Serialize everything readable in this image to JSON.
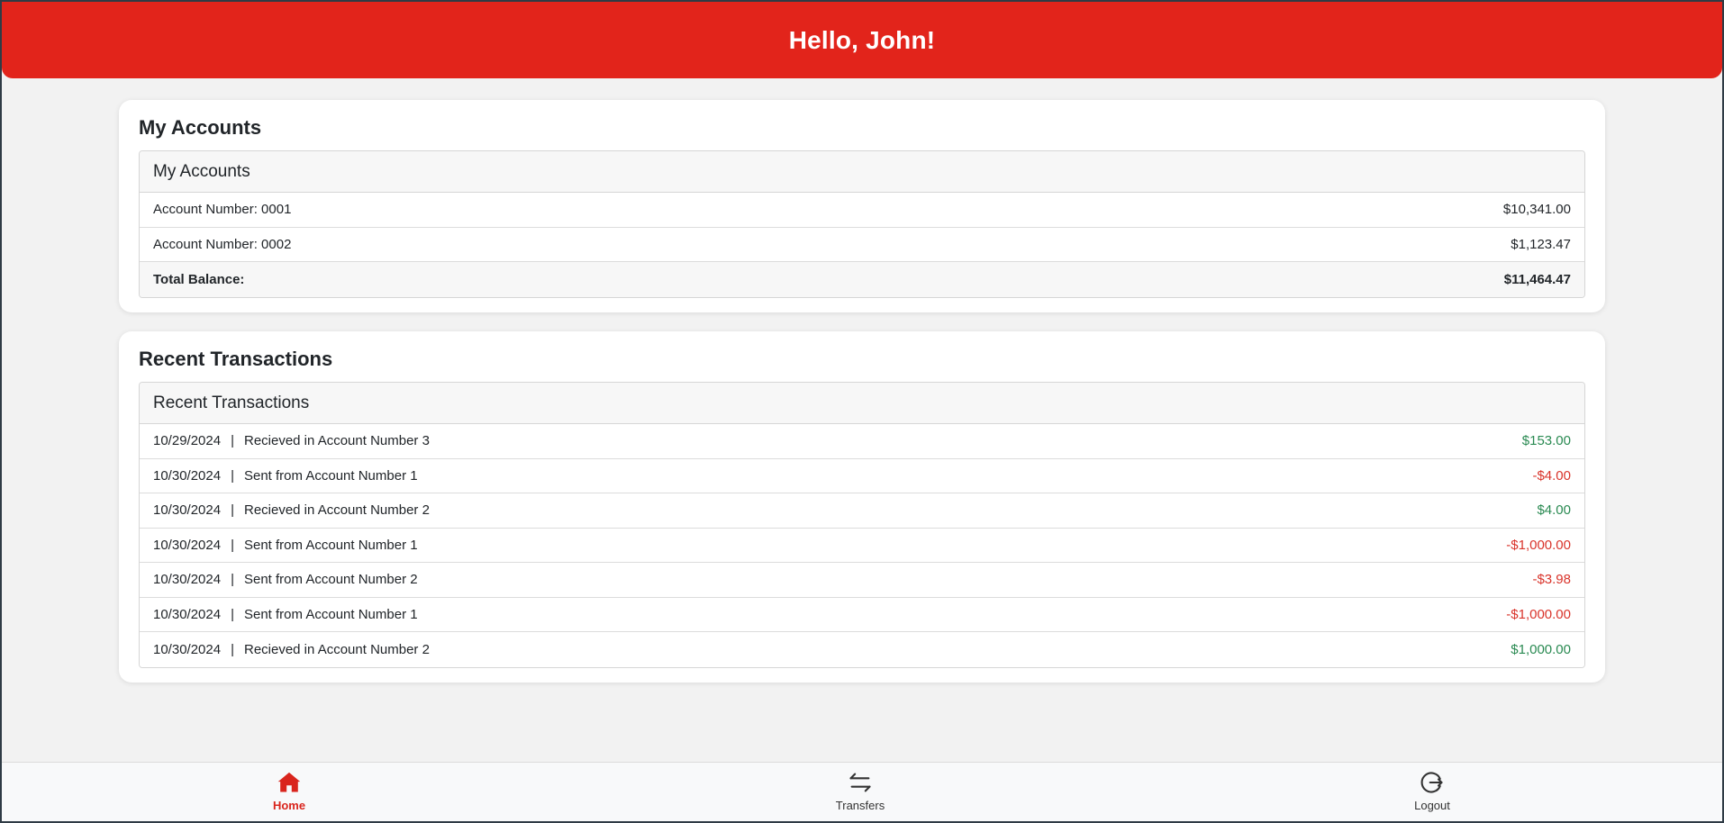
{
  "header": {
    "greeting": "Hello, John!"
  },
  "accounts": {
    "card_title": "My Accounts",
    "panel_title": "My Accounts",
    "rows": [
      {
        "label": "Account Number: 0001",
        "amount": "$10,341.00"
      },
      {
        "label": "Account Number: 0002",
        "amount": "$1,123.47"
      }
    ],
    "total": {
      "label": "Total Balance:",
      "amount": "$11,464.47"
    }
  },
  "transactions": {
    "card_title": "Recent Transactions",
    "panel_title": "Recent Transactions",
    "separator": "|",
    "rows": [
      {
        "date": "10/29/2024",
        "description": "Recieved in Account Number 3",
        "amount": "$153.00"
      },
      {
        "date": "10/30/2024",
        "description": "Sent from Account Number 1",
        "amount": "-$4.00"
      },
      {
        "date": "10/30/2024",
        "description": "Recieved in Account Number 2",
        "amount": "$4.00"
      },
      {
        "date": "10/30/2024",
        "description": "Sent from Account Number 1",
        "amount": "-$1,000.00"
      },
      {
        "date": "10/30/2024",
        "description": "Sent from Account Number 2",
        "amount": "-$3.98"
      },
      {
        "date": "10/30/2024",
        "description": "Sent from Account Number 1",
        "amount": "-$1,000.00"
      },
      {
        "date": "10/30/2024",
        "description": "Recieved in Account Number 2",
        "amount": "$1,000.00"
      }
    ]
  },
  "nav": {
    "home": {
      "label": "Home",
      "icon": "home-icon"
    },
    "transfers": {
      "label": "Transfers",
      "icon": "transfer-arrows-icon"
    },
    "logout": {
      "label": "Logout",
      "icon": "logout-icon"
    }
  },
  "colors": {
    "brand_red": "#e2241b",
    "positive": "#2a8a52",
    "negative": "#d9342b"
  }
}
